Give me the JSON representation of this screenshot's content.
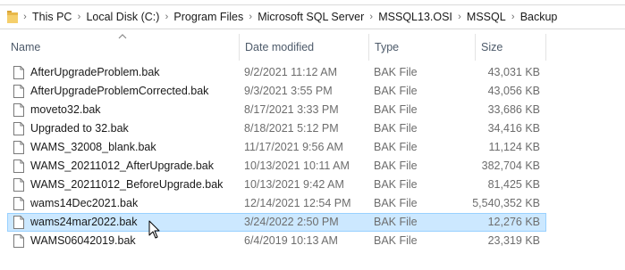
{
  "breadcrumbs": [
    "This PC",
    "Local Disk (C:)",
    "Program Files",
    "Microsoft SQL Server",
    "MSSQL13.OSI",
    "MSSQL",
    "Backup"
  ],
  "columns": {
    "name": "Name",
    "date_modified": "Date modified",
    "type": "Type",
    "size": "Size"
  },
  "sort": {
    "column": "name",
    "direction": "ascending"
  },
  "files": [
    {
      "name": "AfterUpgradeProblem.bak",
      "date": "9/2/2021 11:12 AM",
      "type": "BAK File",
      "size": "43,031 KB"
    },
    {
      "name": "AfterUpgradeProblemCorrected.bak",
      "date": "9/3/2021 3:55 PM",
      "type": "BAK File",
      "size": "43,056 KB"
    },
    {
      "name": "moveto32.bak",
      "date": "8/17/2021 3:33 PM",
      "type": "BAK File",
      "size": "33,686 KB"
    },
    {
      "name": "Upgraded to 32.bak",
      "date": "8/18/2021 5:12 PM",
      "type": "BAK File",
      "size": "34,416 KB"
    },
    {
      "name": "WAMS_32008_blank.bak",
      "date": "11/17/2021 9:56 AM",
      "type": "BAK File",
      "size": "11,124 KB"
    },
    {
      "name": "WAMS_20211012_AfterUpgrade.bak",
      "date": "10/13/2021 10:11 AM",
      "type": "BAK File",
      "size": "382,704 KB"
    },
    {
      "name": "WAMS_20211012_BeforeUpgrade.bak",
      "date": "10/13/2021 9:42 AM",
      "type": "BAK File",
      "size": "81,425 KB"
    },
    {
      "name": "wams14Dec2021.bak",
      "date": "12/14/2021 12:54 PM",
      "type": "BAK File",
      "size": "5,540,352 KB"
    },
    {
      "name": "wams24mar2022.bak",
      "date": "3/24/2022 2:50 PM",
      "type": "BAK File",
      "size": "12,276 KB",
      "selected": true
    },
    {
      "name": "WAMS06042019.bak",
      "date": "6/4/2019 10:13 AM",
      "type": "BAK File",
      "size": "23,319 KB"
    }
  ],
  "colors": {
    "selection_background": "#cce8ff",
    "selection_border": "#99d1ff",
    "folder": "#e8b84a"
  },
  "icons": {
    "address_bar": "folder-icon",
    "breadcrumb_separator": "chevron-right-icon",
    "file": "file-icon",
    "sort": "caret-up-icon",
    "pointer": "mouse-cursor-icon"
  }
}
